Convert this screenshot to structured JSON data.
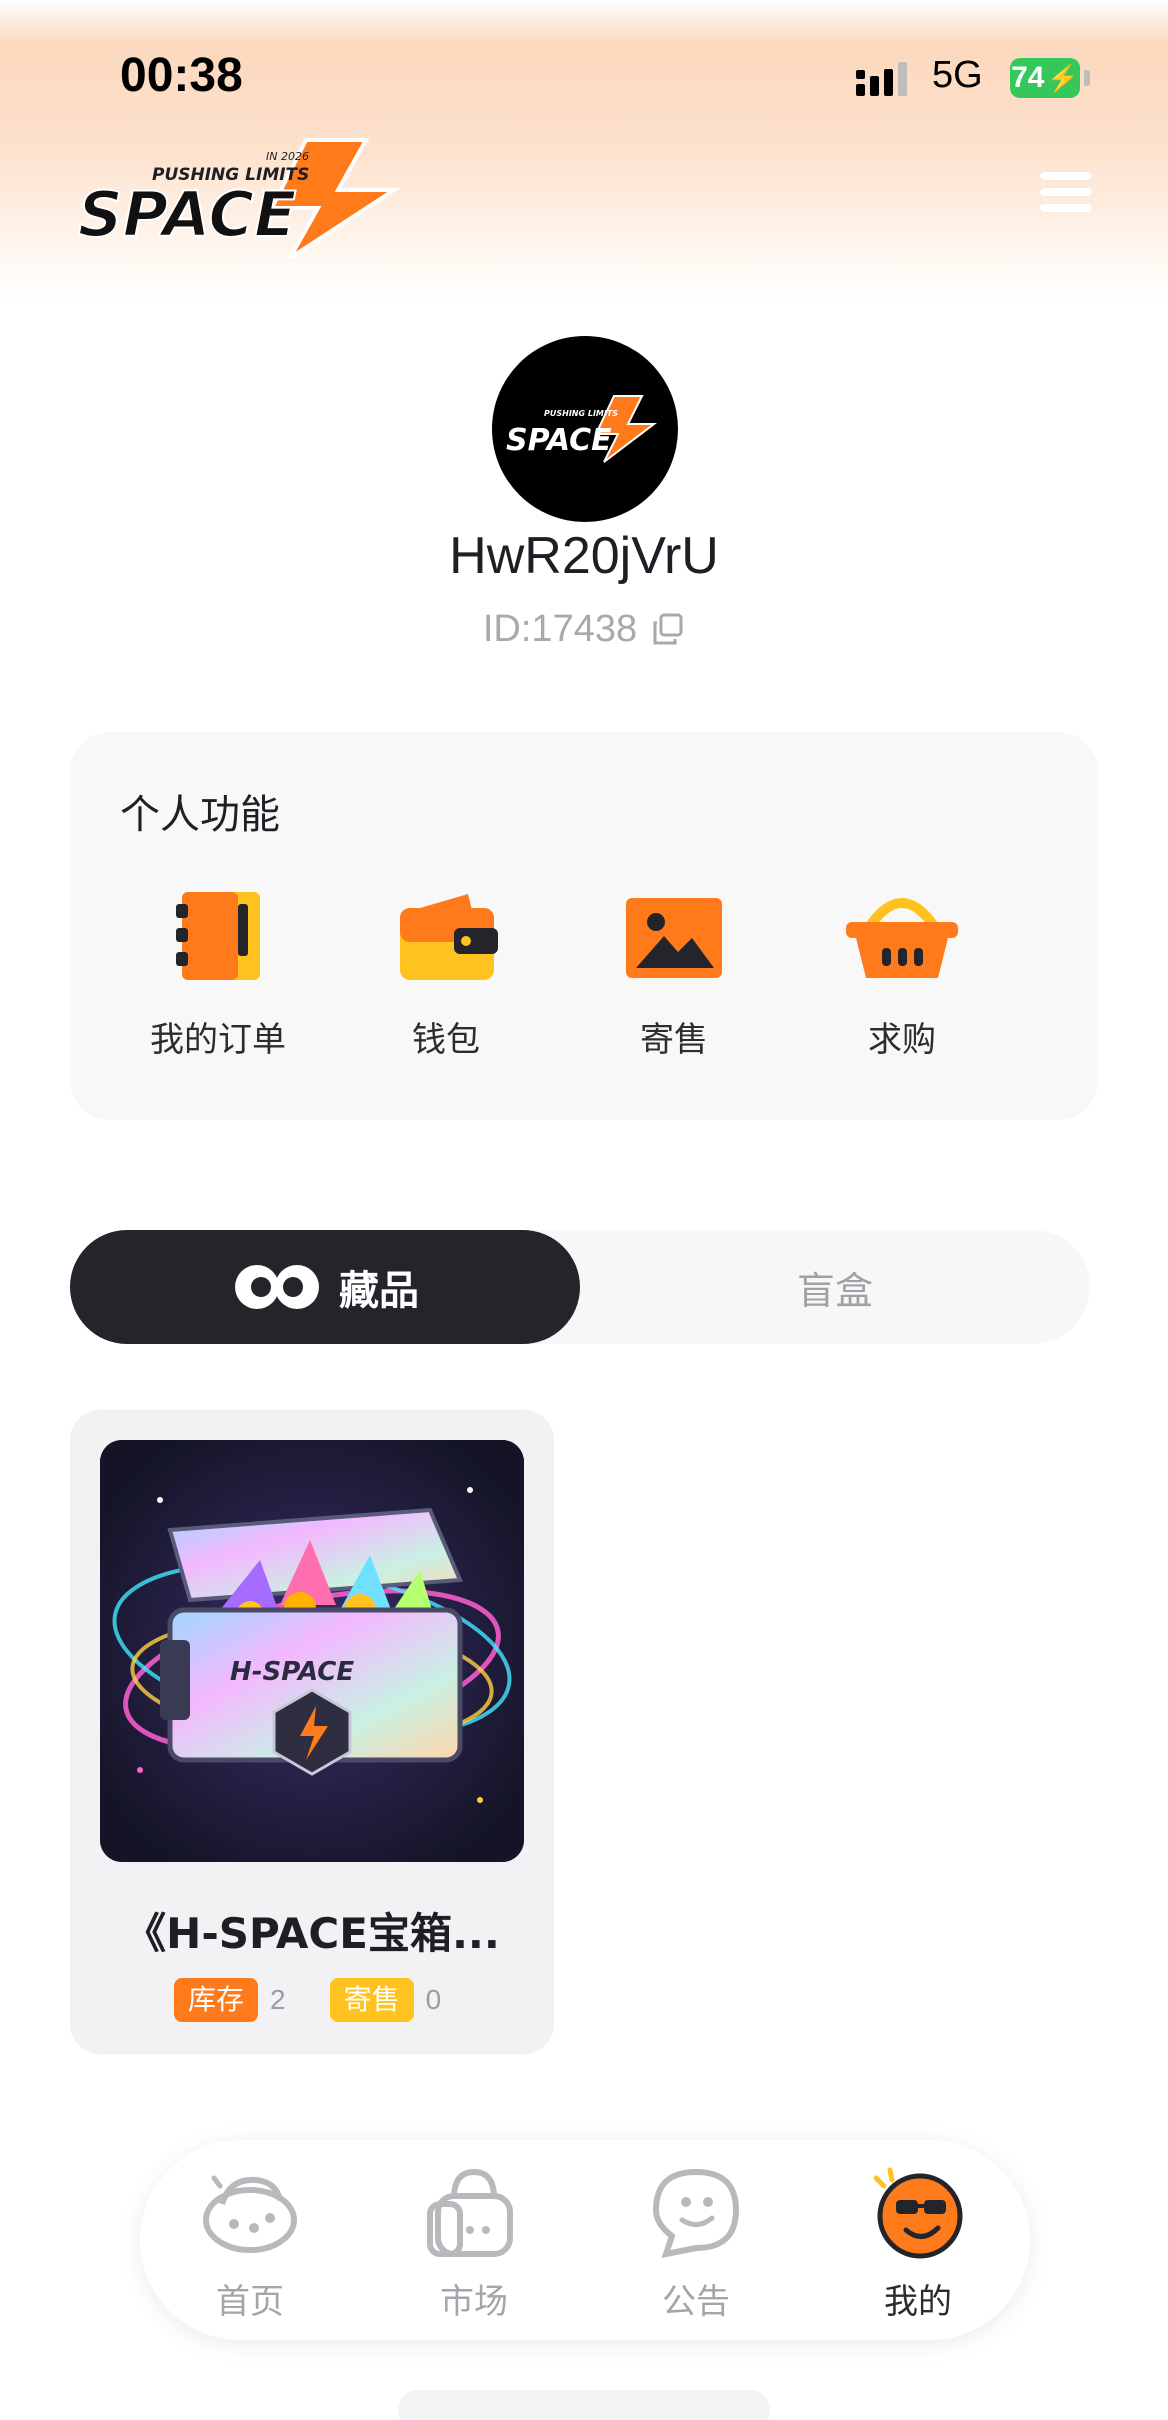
{
  "status_bar": {
    "time": "00:38",
    "network": "5G",
    "battery": "74"
  },
  "header": {
    "logo_tagline": "PUSHING LIMITS",
    "logo_year": "IN 2026",
    "logo_text": "SPACE"
  },
  "profile": {
    "username": "HwR20jVrU",
    "user_id": "ID:17438"
  },
  "functions": {
    "title": "个人功能",
    "items": [
      {
        "label": "我的订单",
        "icon": "order-book-icon"
      },
      {
        "label": "钱包",
        "icon": "wallet-icon"
      },
      {
        "label": "寄售",
        "icon": "image-consign-icon"
      },
      {
        "label": "求购",
        "icon": "basket-icon"
      }
    ]
  },
  "tabs": {
    "active": "藏品",
    "inactive": "盲盒"
  },
  "collection": [
    {
      "name": "《H-SPACE宝箱...",
      "image_text": "H-SPACE",
      "stock_label": "库存",
      "stock_value": "2",
      "sale_label": "寄售",
      "sale_value": "0"
    }
  ],
  "bottom_nav": [
    {
      "label": "首页",
      "icon": "home-planet-icon",
      "active": false
    },
    {
      "label": "市场",
      "icon": "market-bag-icon",
      "active": false
    },
    {
      "label": "公告",
      "icon": "announcement-bubble-icon",
      "active": false
    },
    {
      "label": "我的",
      "icon": "profile-face-icon",
      "active": true
    }
  ],
  "colors": {
    "accent": "#ff7a1a",
    "accent_yellow": "#ffc21f",
    "dark": "#24252b",
    "muted": "#a4a5aa"
  }
}
